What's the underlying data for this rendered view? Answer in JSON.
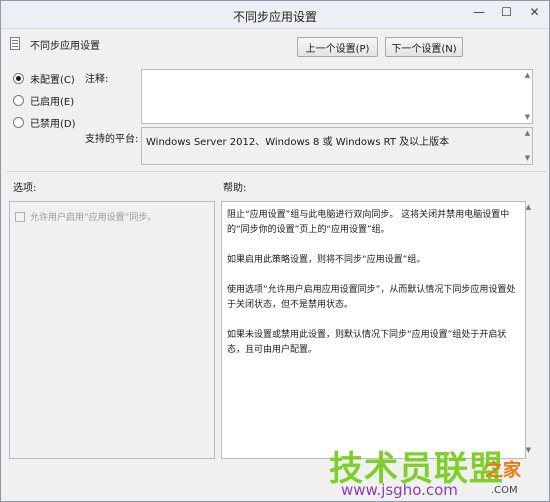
{
  "window": {
    "title": "不同步应用设置",
    "minimize_glyph": "—",
    "maximize_glyph": "☐",
    "close_glyph": "✕"
  },
  "header": {
    "policy_name": "不同步应用设置",
    "prev_button": "上一个设置(P)",
    "next_button": "下一个设置(N)"
  },
  "state": {
    "options": [
      {
        "label": "未配置(C)",
        "checked": true
      },
      {
        "label": "已启用(E)",
        "checked": false
      },
      {
        "label": "已禁用(D)",
        "checked": false
      }
    ]
  },
  "labels": {
    "comment": "注释:",
    "supported_on": "支持的平台:",
    "options": "选项:",
    "help": "帮助:"
  },
  "comment": {
    "value": ""
  },
  "supported_platform": "Windows Server 2012、Windows 8 或 Windows RT 及以上版本",
  "options_panel": {
    "checkbox_label": "允许用户启用“应用设置”同步。"
  },
  "help_text": {
    "p1": "阻止“应用设置”组与此电脑进行双向同步。 这将关闭并禁用电脑设置中的“同步你的设置”页上的“应用设置”组。",
    "p2": "如果启用此策略设置，则将不同步“应用设置”组。",
    "p3": "使用选项“允许用户启用应用设置同步”，从而默认情况下同步应用设置处于关闭状态，但不是禁用状态。",
    "p4": "如果未设置或禁用此设置，则默认情况下同步“应用设置”组处于开启状态，且可由用户配置。"
  },
  "watermark": {
    "main": "技术员联盟",
    "url": "www.jsgho.com",
    "side": "之家",
    "suffix": ".COM"
  }
}
